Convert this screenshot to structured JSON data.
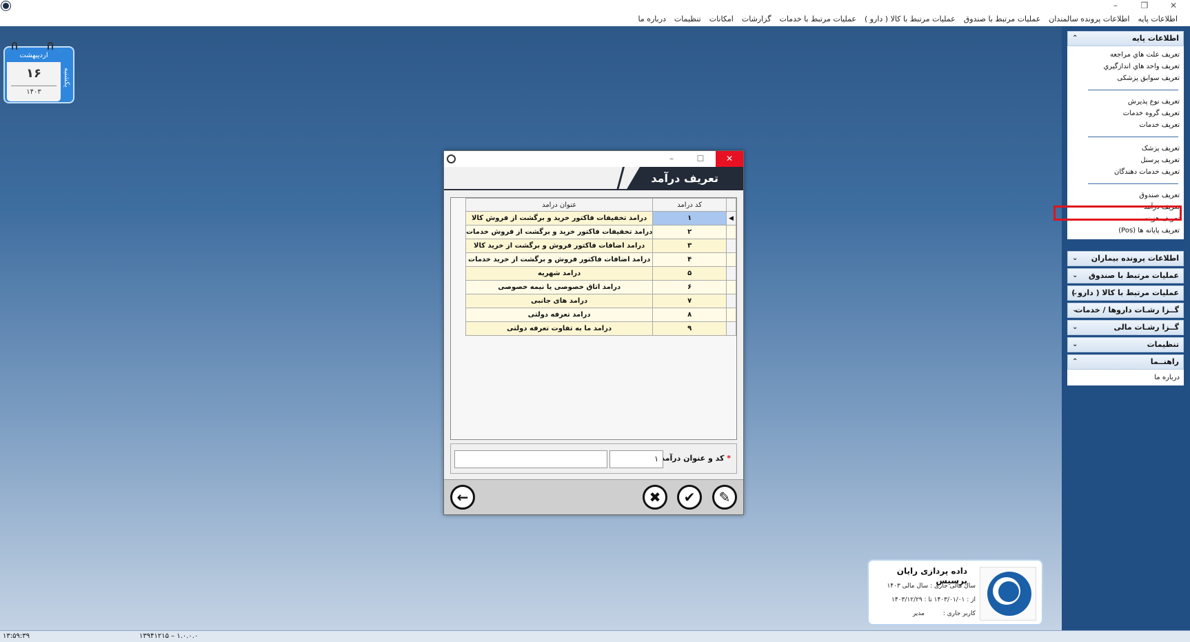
{
  "window": {
    "minimize_glyph": "–",
    "maximize_glyph": "❐",
    "close_glyph": "✕"
  },
  "menubar": {
    "items": [
      "اطلاعات پایه",
      "اطلاعات پرونده سالمندان",
      "عملیات مرتبط با صندوق",
      "عملیات مرتبط با کالا ( دارو )",
      "عملیات مرتبط با خدمات",
      "گزارشات",
      "امکانات",
      "تنظیمات",
      "درباره ما"
    ]
  },
  "calendar": {
    "month": "اردیبهشت",
    "day": "۱۶",
    "year": "۱۴۰۳",
    "weekday": "یکشنبه"
  },
  "sidebar": {
    "base_info": {
      "title": "اطلاعات پایه",
      "chevron": "⌃",
      "items_a": [
        "تعریف علت هاي مراجعه",
        "تعریف واحد هاي اندازگیري",
        "تعریف سوابق پزشکی"
      ],
      "items_b": [
        "تعریف نوع پذیرش",
        "تعریف گروه خدمات",
        "تعریف خدمات"
      ],
      "items_c": [
        "تعریف پزشک",
        "تعریف پرسنل",
        "تعریف خدمات دهندگان"
      ],
      "items_d": [
        "تعریف صندوق",
        "تعریف درآمد",
        "تعریف هزینه",
        "تعریف پایانه ها (Pos)"
      ]
    },
    "collapsed_groups": [
      "اطلاعات پرونده بیماران",
      "عملیات مرتبط با صندوق",
      "عملیات مرتبط با کالا ( دارو )",
      "گــزا رشـات داروها / خدمات",
      "گــزا رشـات مالی",
      "تنظیمات"
    ],
    "collapsed_chevron": "⌄",
    "help": {
      "title": "راهنــما",
      "chevron": "⌃",
      "items": [
        "درباره ما"
      ]
    }
  },
  "dialog": {
    "title": "تعریف درآمد",
    "minimize_glyph": "–",
    "maximize_glyph": "☐",
    "close_glyph": "✕",
    "columns": {
      "code": "کد درامد",
      "title": "عنوان درامد"
    },
    "current_row_indicator": "◀",
    "rows": [
      {
        "code": "۱",
        "title": "درامد تخفیفات فاکتور خرید و برگشت از فروش کالا"
      },
      {
        "code": "۲",
        "title": "درامد تخفیفات فاکتور خرید و برگشت از فروش خدمات"
      },
      {
        "code": "۳",
        "title": "درامد اضافات فاکتور فروش و برگشت از خرید کالا"
      },
      {
        "code": "۴",
        "title": "درامد اضافات فاکتور فروش و برگشت از خرید خدمات"
      },
      {
        "code": "۵",
        "title": "درامد شهریه"
      },
      {
        "code": "۶",
        "title": "درامد اتاق خصوصی یا نیمه خصوصی"
      },
      {
        "code": "۷",
        "title": "درامد های جانبی"
      },
      {
        "code": "۸",
        "title": "درامد تعرفه دولتی"
      },
      {
        "code": "۹",
        "title": "درامد ما به تفاوت تعرفه دولتی"
      }
    ],
    "form": {
      "required_mark": "*",
      "label": "کد و عنوان درآمد :",
      "code_value": "۱",
      "title_value": ""
    },
    "buttons": {
      "back_glyph": "←",
      "cancel_glyph": "✖",
      "confirm_glyph": "✔",
      "edit_glyph": "✎"
    }
  },
  "company": {
    "name": "داده پردازی رایان پرسیس",
    "fiscal_label": "سال مالی جاری :",
    "fiscal_value": "سال مالی ۱۴۰۳",
    "range": "از : ۱۴۰۳/۰۱/۰۱    تا : ۱۴۰۳/۱۲/۲۹",
    "user_label": "کاربر جاری :",
    "user_value": "مدیر"
  },
  "statusbar": {
    "time": "۱۳:۵۹:۳۹",
    "version": "۱۳۹۴۱۲۱۵ – ۱.۰.۰.۰"
  },
  "colors": {
    "desktop_top": "#2d5888",
    "sidebar": "#214f84",
    "highlight_box": "#e0141c",
    "dialog_header": "#232a38",
    "selected_cell": "#a8c6ee",
    "row_fill": "#fdf6d3",
    "close_red": "#e81123"
  }
}
